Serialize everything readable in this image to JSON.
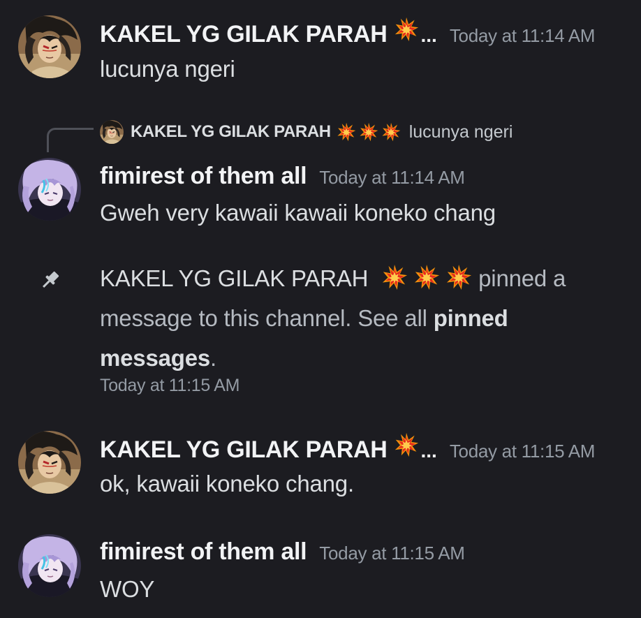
{
  "messages": [
    {
      "username": "KAKEL YG GILAK PARAH",
      "name_suffix": "...",
      "timestamp": "Today at 11:14 AM",
      "text": "lucunya ngeri"
    },
    {
      "reply": {
        "username": "KAKEL YG GILAK PARAH",
        "text": "lucunya ngeri"
      },
      "username": "fimirest of them all",
      "timestamp": "Today at 11:14 AM",
      "text": "Gweh very kawaii kawaii koneko chang"
    },
    {
      "username": "KAKEL YG GILAK PARAH",
      "name_suffix": "...",
      "timestamp": "Today at 11:15 AM",
      "text": "ok, kawaii koneko chang."
    },
    {
      "username": "fimirest of them all",
      "timestamp": "Today at 11:15 AM",
      "text": "WOY"
    }
  ],
  "system_pin": {
    "username": "KAKEL YG GILAK PARAH",
    "action_text": " pinned a message to this channel. See all ",
    "link_text": "pinned messages",
    "end_text": ".",
    "timestamp": "Today at 11:15 AM"
  },
  "icons": {
    "collision": "collision-emoji-icon",
    "pin": "pin-icon"
  },
  "colors": {
    "background": "#1c1c21",
    "username": "#f2f3f5",
    "timestamp": "#949ba4",
    "text": "#dbdee1"
  }
}
